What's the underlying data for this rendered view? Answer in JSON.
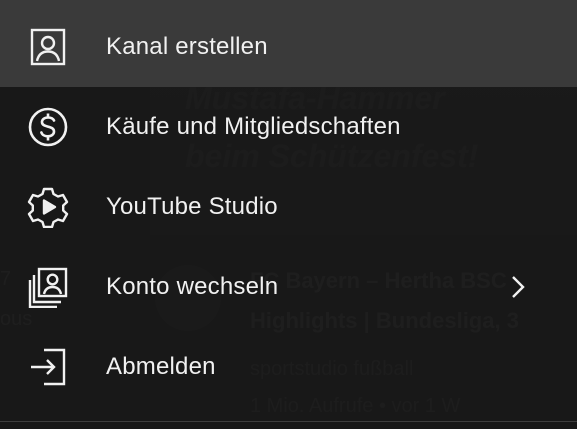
{
  "menu": {
    "items": [
      {
        "label": "Kanal erstellen",
        "icon": "account-box-icon",
        "active": true
      },
      {
        "label": "Käufe und Mitgliedschaften",
        "icon": "dollar-circle-icon"
      },
      {
        "label": "YouTube Studio",
        "icon": "studio-gear-play-icon"
      },
      {
        "label": "Konto wechseln",
        "icon": "switch-account-icon",
        "has_submenu": true
      },
      {
        "label": "Abmelden",
        "icon": "sign-out-icon"
      }
    ]
  },
  "background": {
    "thumbnail_headline_1": "Mustafa-Hammer",
    "thumbnail_headline_2": "beim Schützenfest!",
    "video_title_1": "FC Bayern – Hertha BSC",
    "video_title_2": "Highlights | Bundesliga, 3",
    "channel": "sportstudio fußball",
    "meta": "1 Mio. Aufrufe • vor 1 W",
    "left_fragment_1": "7",
    "left_fragment_2": "ous"
  },
  "colors": {
    "menu_background": "#181818",
    "active_item": "#3a3a3a",
    "text": "#f1f1f1"
  }
}
